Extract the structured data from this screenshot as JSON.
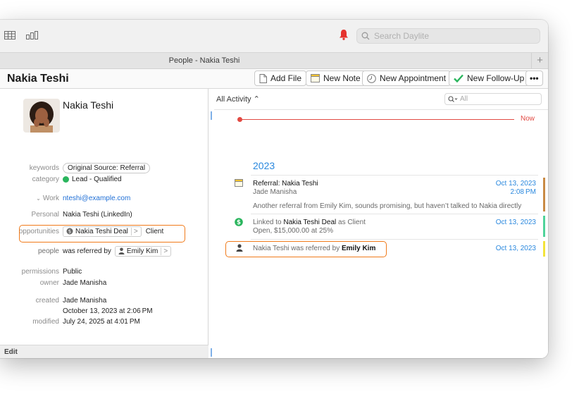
{
  "search": {
    "placeholder": "Search Daylite"
  },
  "tab": {
    "title": "People - Nakia Teshi",
    "add_label": "+"
  },
  "header": {
    "name": "Nakia Teshi",
    "buttons": {
      "add_file": "Add File",
      "new_note": "New Note",
      "new_appointment": "New Appointment",
      "new_follow_up": "New Follow-Up",
      "more": "•••"
    }
  },
  "contact": {
    "name": "Nakia Teshi",
    "fields": {
      "keywords_label": "keywords",
      "keywords_value": "Original Source: Referral",
      "category_label": "category",
      "category_value": "Lead - Qualified",
      "work_label": "Work",
      "work_value": "nteshi@example.com",
      "personal_label": "Personal",
      "personal_value": "Nakia Teshi (LinkedIn)",
      "opportunities_label": "opportunities",
      "opportunity_name": "Nakia Teshi Deal",
      "opportunity_role": "Client",
      "people_label": "people",
      "people_relation": "was referred by",
      "people_person": "Emily Kim",
      "permissions_label": "permissions",
      "permissions_value": "Public",
      "owner_label": "owner",
      "owner_value": "Jade Manisha",
      "created_label": "created",
      "created_by": "Jade Manisha",
      "created_date": "October 13, 2023 at 2:06 PM",
      "modified_label": "modified",
      "modified_date": "July 24, 2025 at 4:01 PM"
    },
    "edit_label": "Edit"
  },
  "activity": {
    "filter_label": "All Activity ⌃",
    "search_placeholder": "All",
    "now_label": "Now",
    "year": "2023",
    "items": [
      {
        "title": "Referral: Nakia Teshi",
        "subtitle": "Jade Manisha",
        "note": "Another referral from Emily Kim, sounds promising, but haven’t talked to Nakia directly",
        "date": "Oct 13, 2023",
        "time": "2:08 PM",
        "bar_color": "#c98a44"
      },
      {
        "title_pre": "Linked to ",
        "title_bold": "Nakia Teshi Deal",
        "title_post": " as Client",
        "subtitle": "Open, $15,000.00 at 25%",
        "date": "Oct 13, 2023",
        "bar_color": "#4fd39a"
      },
      {
        "title_pre": "Nakia Teshi was referred by ",
        "title_bold": "Emily Kim",
        "date": "Oct 13, 2023",
        "bar_color": "#f3e33a"
      }
    ]
  },
  "colors": {
    "accent": "#2a88de",
    "now_line": "#e24a43",
    "highlight": "#f07a1a"
  }
}
